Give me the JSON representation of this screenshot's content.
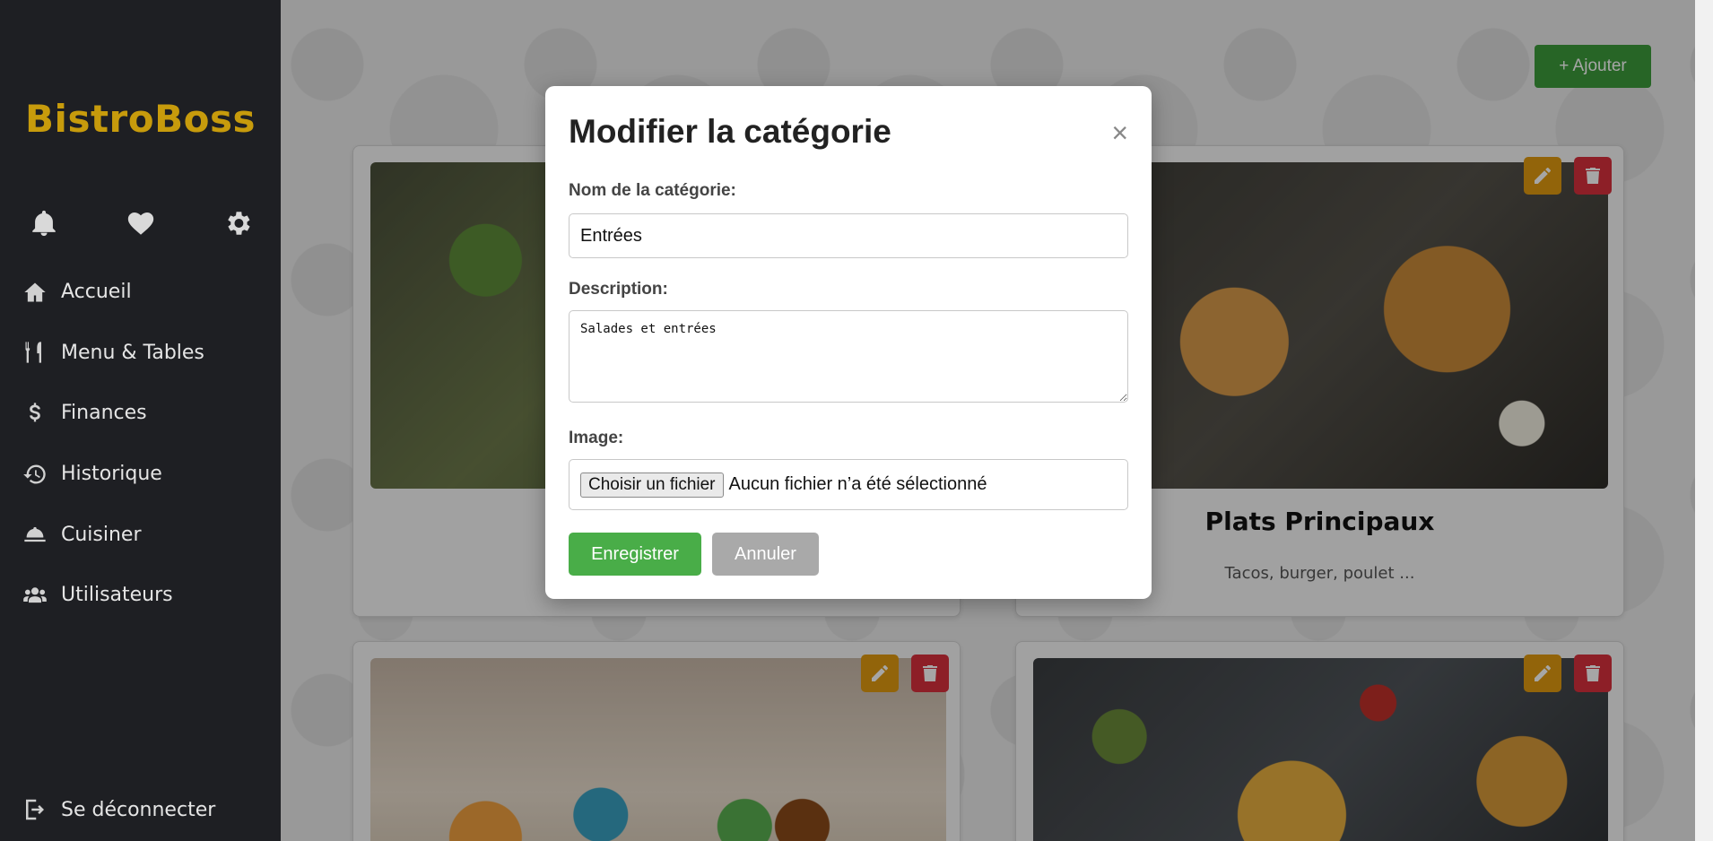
{
  "app": {
    "brand": "BistroBoss"
  },
  "sidebar": {
    "quick_icons": [
      "bell-icon",
      "heart-icon",
      "gear-icon"
    ],
    "items": [
      {
        "label": "Accueil",
        "icon": "home-icon"
      },
      {
        "label": "Menu & Tables",
        "icon": "utensils-icon"
      },
      {
        "label": "Finances",
        "icon": "dollar-icon"
      },
      {
        "label": "Historique",
        "icon": "history-icon"
      },
      {
        "label": "Cuisiner",
        "icon": "cloche-icon"
      },
      {
        "label": "Utilisateurs",
        "icon": "users-icon"
      }
    ],
    "logout_label": "Se déconnecter"
  },
  "main": {
    "add_button": "+ Ajouter",
    "cards": [
      {
        "title": "",
        "description": ""
      },
      {
        "title": "Plats Principaux",
        "description": "Tacos, burger, poulet ..."
      },
      {
        "title": "",
        "description": ""
      },
      {
        "title": "",
        "description": ""
      }
    ]
  },
  "modal": {
    "title": "Modifier la catégorie",
    "close_label": "×",
    "name_label": "Nom de la catégorie:",
    "name_value": "Entrées",
    "description_label": "Description:",
    "description_value": "Salades et entrées",
    "image_label": "Image:",
    "file_button": "Choisir un fichier",
    "file_status": "Aucun fichier n’a été sélectionné",
    "save_label": "Enregistrer",
    "cancel_label": "Annuler"
  },
  "colors": {
    "accent": "#c79b0c",
    "sidebar_bg": "#1e1f23",
    "success": "#49ad48",
    "edit": "#e19a10",
    "delete": "#d9313d"
  }
}
